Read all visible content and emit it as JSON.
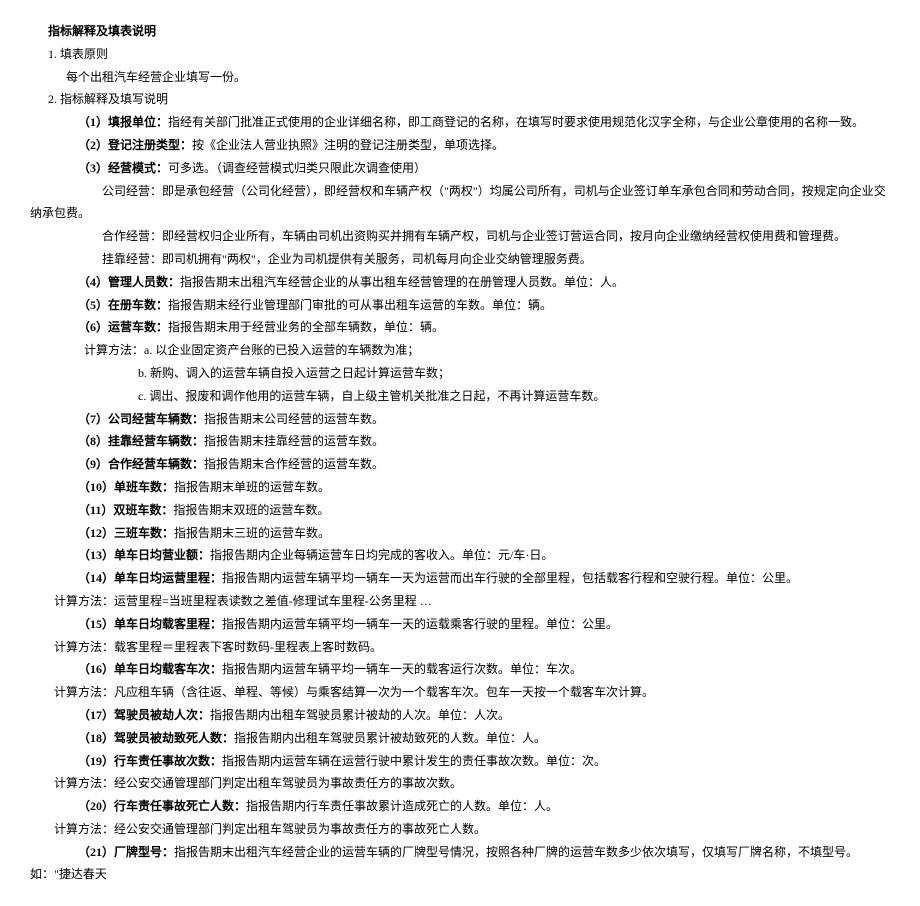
{
  "title": "指标解释及填表说明",
  "section1": {
    "heading": "1. 填表原则",
    "content": "每个出租汽车经营企业填写一份。"
  },
  "section2": {
    "heading": "2. 指标解释及填写说明",
    "items": {
      "i1": {
        "label": "（1）填报单位：",
        "text": "指经有关部门批准正式使用的企业详细名称，即工商登记的名称，在填写时要求使用规范化汉字全称，与企业公章使用的名称一致。"
      },
      "i2": {
        "label": "（2）登记注册类型：",
        "text": "按《企业法人营业执照》注明的登记注册类型，单项选择。"
      },
      "i3": {
        "label": "（3）经营模式：",
        "text": "可多选。（调查经营模式归类只限此次调查使用）"
      },
      "i3a": "公司经营：即是承包经营（公司化经营），即经营权和车辆产权（\"两权\"）均属公司所有，司机与企业签订单车承包合同和劳动合同，按规定向企业交纳承包费。",
      "i3b": "合作经营：即经营权归企业所有，车辆由司机出资购买并拥有车辆产权，司机与企业签订营运合同，按月向企业缴纳经营权使用费和管理费。",
      "i3c": "挂靠经营：即司机拥有\"两权\"，企业为司机提供有关服务，司机每月向企业交纳管理服务费。",
      "i4": {
        "label": "（4）管理人员数：",
        "text": "指报告期末出租汽车经营企业的从事出租车经营管理的在册管理人员数。单位：人。"
      },
      "i5": {
        "label": "（5）在册车数：",
        "text": "指报告期末经行业管理部门审批的可从事出租车运营的车数。单位：辆。"
      },
      "i6": {
        "label": "（6）运营车数：",
        "text": "指报告期末用于经营业务的全部车辆数，单位：辆。"
      },
      "i6calc": "计算方法：a. 以企业固定资产台账的已投入运营的车辆数为准；",
      "i6calcb": "b. 新购、调入的运营车辆自投入运营之日起计算运营车数；",
      "i6calcc": "c. 调出、报废和调作他用的运营车辆，自上级主管机关批准之日起，不再计算运营车数。",
      "i7": {
        "label": "（7）公司经营车辆数：",
        "text": "指报告期末公司经营的运营车数。"
      },
      "i8": {
        "label": "（8）挂靠经营车辆数：",
        "text": "指报告期末挂靠经营的运营车数。"
      },
      "i9": {
        "label": "（9）合作经营车辆数：",
        "text": "指报告期末合作经营的运营车数。"
      },
      "i10": {
        "label": "（10）单班车数：",
        "text": "指报告期末单班的运营车数。"
      },
      "i11": {
        "label": "（11）双班车数：",
        "text": "指报告期末双班的运营车数。"
      },
      "i12": {
        "label": "（12）三班车数：",
        "text": "指报告期末三班的运营车数。"
      },
      "i13": {
        "label": "（13）单车日均营业额：",
        "text": "指报告期内企业每辆运营车日均完成的客收入。单位：元/车·日。"
      },
      "i14": {
        "label": "（14）单车日均运营里程：",
        "text": "指报告期内运营车辆平均一辆车一天为运营而出车行驶的全部里程，包括载客行程和空驶行程。单位：公里。"
      },
      "i14calc": "计算方法：运营里程=当班里程表读数之差值-修理试车里程-公务里程 …",
      "i15": {
        "label": "（15）单车日均载客里程：",
        "text": "指报告期内运营车辆平均一辆车一天的运载乘客行驶的里程。单位：公里。"
      },
      "i15calc": "计算方法：载客里程＝里程表下客时数码-里程表上客时数码。",
      "i16": {
        "label": "（16）单车日均载客车次：",
        "text": "指报告期内运营车辆平均一辆车一天的载客运行次数。单位：车次。"
      },
      "i16calc": "计算方法：凡应租车辆（含往返、单程、等候）与乘客结算一次为一个载客车次。包车一天按一个载客车次计算。",
      "i17": {
        "label": "（17）驾驶员被劫人次：",
        "text": "指报告期内出租车驾驶员累计被劫的人次。单位：人次。"
      },
      "i18": {
        "label": "（18）驾驶员被劫致死人数：",
        "text": "指报告期内出租车驾驶员累计被劫致死的人数。单位：人。"
      },
      "i19": {
        "label": "（19）行车责任事故次数：",
        "text": "指报告期内运营车辆在运营行驶中累计发生的责任事故次数。单位：次。"
      },
      "i19calc": "计算方法：经公安交通管理部门判定出租车驾驶员为事故责任方的事故次数。",
      "i20": {
        "label": "（20）行车责任事故死亡人数：",
        "text": "指报告期内行车责任事故累计造成死亡的人数。单位：人。"
      },
      "i20calc": "计算方法：经公安交通管理部门判定出租车驾驶员为事故责任方的事故死亡人数。",
      "i21": {
        "label": "（21）厂牌型号：",
        "text": "指报告期末出租汽车经营企业的运营车辆的厂牌型号情况，按照各种厂牌的运营车数多少依次填写，仅填写厂牌名称，不填型号。如：\"捷达春天"
      }
    }
  }
}
